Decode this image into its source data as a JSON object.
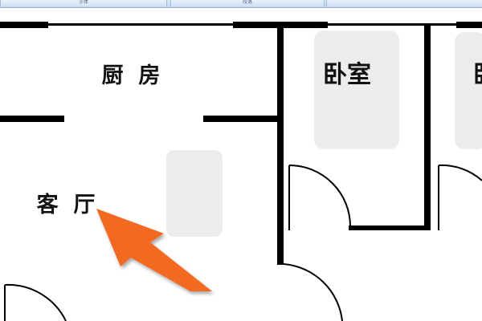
{
  "toolbar": {
    "tabs": [
      {
        "label": "字体"
      },
      {
        "label": "段落"
      },
      {
        "label": ""
      }
    ]
  },
  "floorplan": {
    "rooms": [
      {
        "name": "厨  房"
      },
      {
        "name": "卧室"
      },
      {
        "name": "卧"
      },
      {
        "name": "客  厅"
      }
    ]
  },
  "colors": {
    "wall": "#000000",
    "fixture": "#ececec",
    "arrow": "#f26a21"
  }
}
